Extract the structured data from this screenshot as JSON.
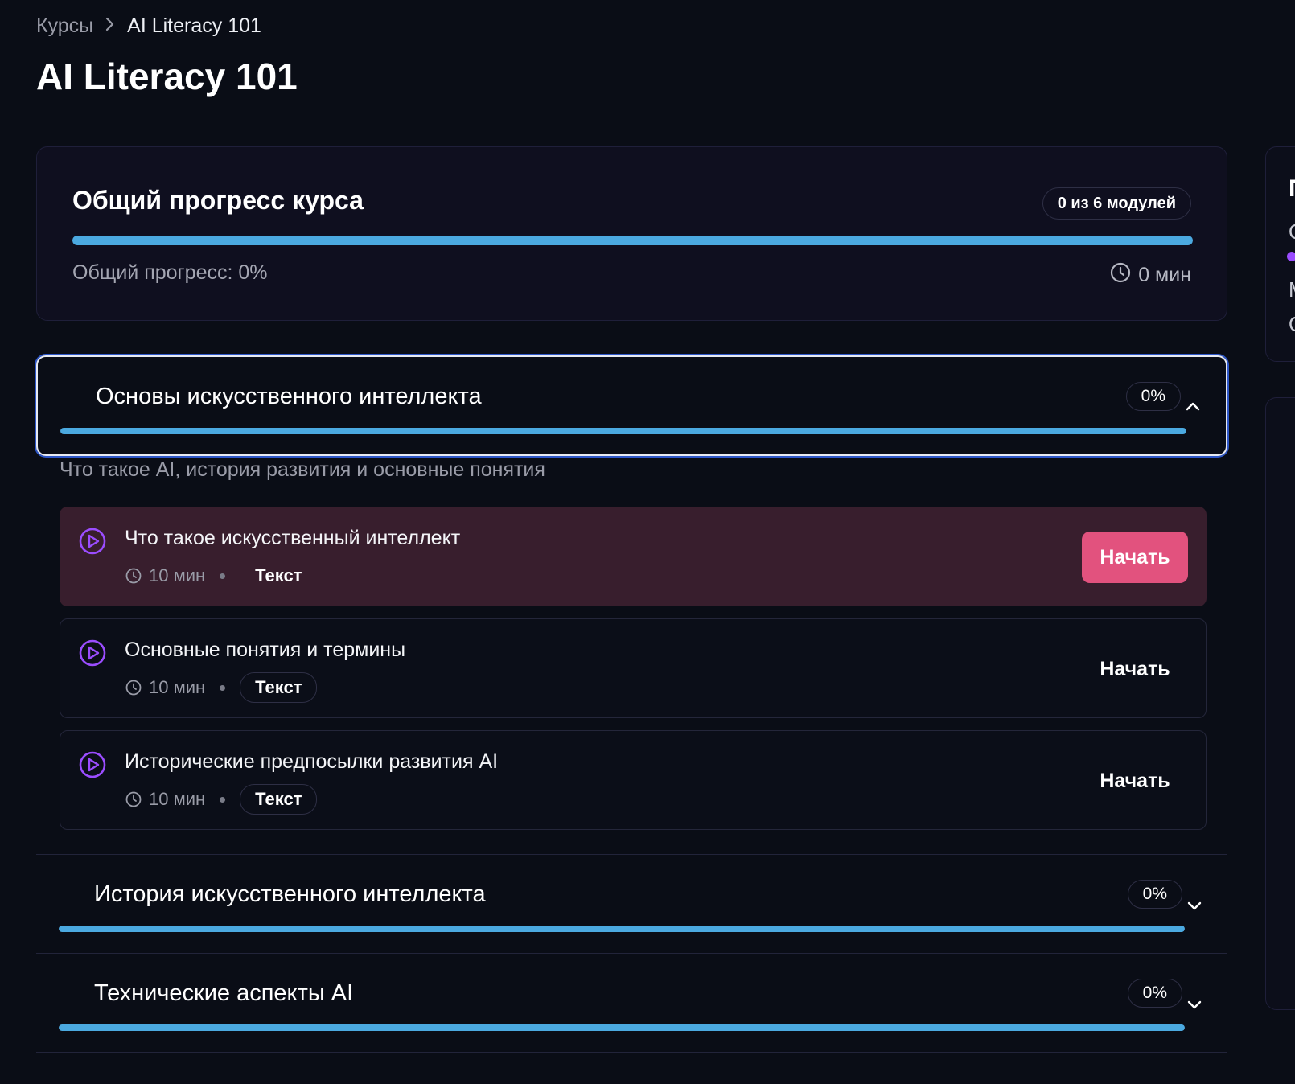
{
  "breadcrumb": {
    "root": "Курсы",
    "current": "AI Literacy 101"
  },
  "page_title": "AI Literacy 101",
  "overall": {
    "title": "Общий прогресс курса",
    "badge": "0 из 6 модулей",
    "progress_label": "Общий прогресс: 0%",
    "time": "0 мин",
    "progress_fraction": 1.0
  },
  "modules": [
    {
      "title": "Основы искусственного интеллекта",
      "percent": "0%",
      "expanded": true,
      "description": "Что такое AI, история развития и основные понятия",
      "lessons": [
        {
          "title": "Что такое искусственный интеллект",
          "duration": "10 мин",
          "type": "Текст",
          "action": "Начать",
          "current": true
        },
        {
          "title": "Основные понятия и термины",
          "duration": "10 мин",
          "type": "Текст",
          "action": "Начать",
          "current": false
        },
        {
          "title": "Исторические предпосылки развития AI",
          "duration": "10 мин",
          "type": "Текст",
          "action": "Начать",
          "current": false
        }
      ]
    },
    {
      "title": "История искусственного интеллекта",
      "percent": "0%",
      "expanded": false
    },
    {
      "title": "Технические аспекты AI",
      "percent": "0%",
      "expanded": false
    }
  ],
  "right_panel": {
    "frag1": "П",
    "frag2": "О",
    "frag3": "М",
    "frag4": "О"
  },
  "colors": {
    "accent": "#4ba9e0",
    "primary_button": "#e2527e",
    "icon_purple": "#9b4dff",
    "background": "#0a0d16"
  },
  "icons": {
    "breadcrumb_separator": "chevron-right-icon",
    "lesson": "play-circle-icon",
    "duration": "clock-icon",
    "expand": "chevron-up-icon",
    "collapse": "chevron-down-icon"
  }
}
